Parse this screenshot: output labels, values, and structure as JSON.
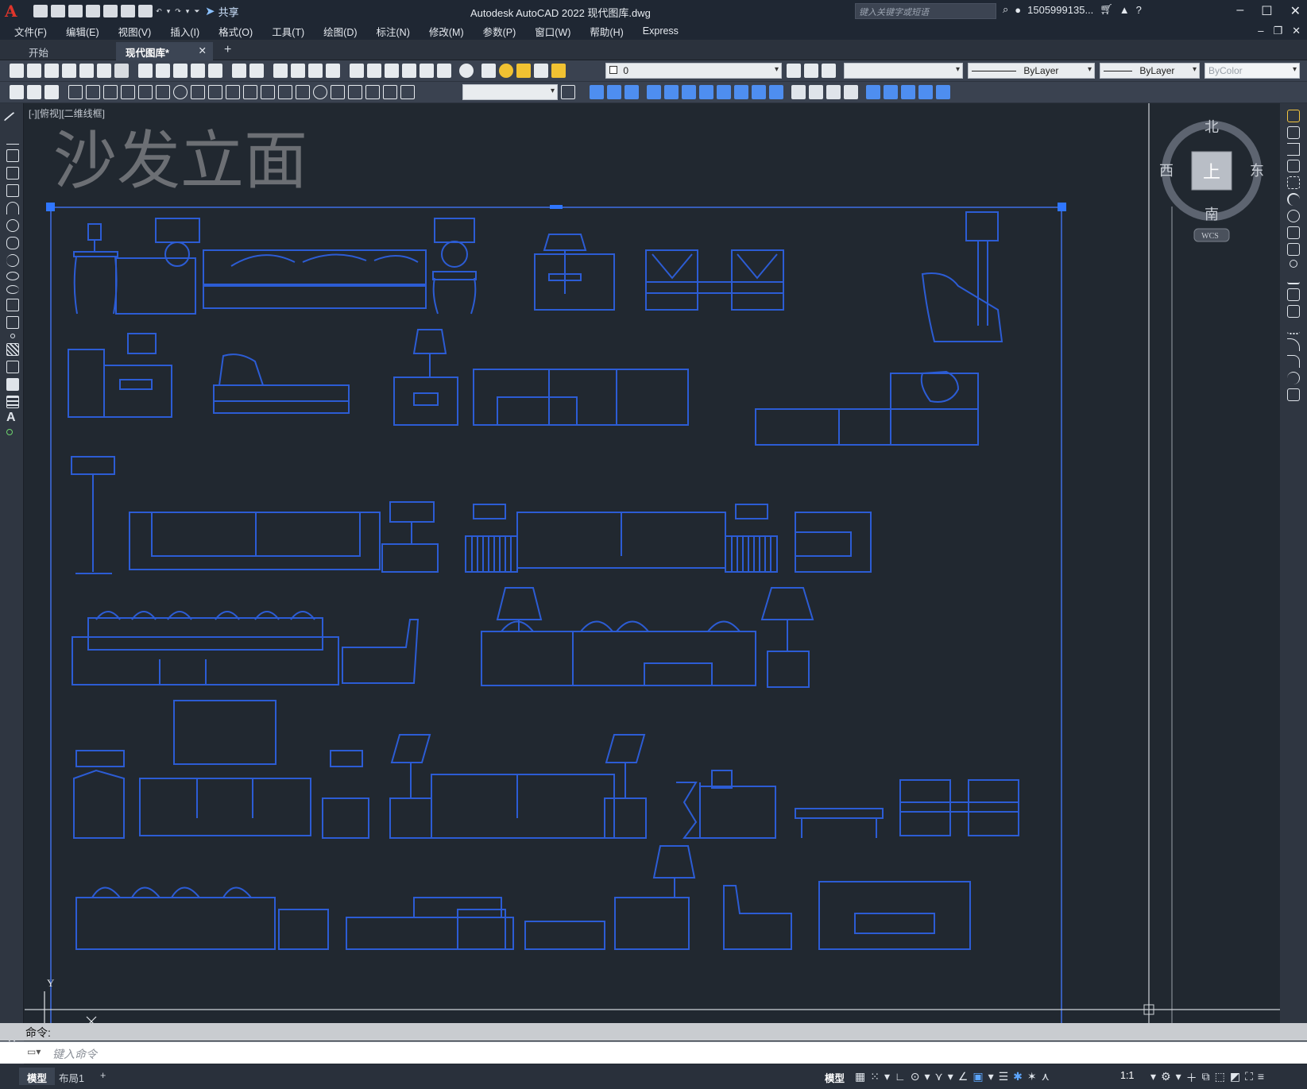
{
  "titlebar": {
    "app_logo": "A",
    "share_label": "共享",
    "title": "Autodesk AutoCAD 2022    现代图库.dwg",
    "search_placeholder": "键入关键字或短语",
    "user_name": "1505999135...",
    "help_label": "?"
  },
  "menu": {
    "items": [
      "文件(F)",
      "编辑(E)",
      "视图(V)",
      "插入(I)",
      "格式(O)",
      "工具(T)",
      "绘图(D)",
      "标注(N)",
      "修改(M)",
      "参数(P)",
      "窗口(W)",
      "帮助(H)",
      "Express"
    ]
  },
  "tabs": {
    "start": "开始",
    "active_doc": "现代图库*",
    "close": "✕",
    "add": "+"
  },
  "toolbar": {
    "layer_value": "0",
    "linetype_value": "ByLayer",
    "lineweight_value": "ByLayer",
    "color_value": "ByColor"
  },
  "viewport": {
    "label": "[-][俯视][二维线框]",
    "drawing_title": "沙发立面"
  },
  "viewcube": {
    "north": "北",
    "south": "南",
    "west": "西",
    "east": "东",
    "top_face": "上",
    "wcs": "WCS"
  },
  "ucs": {
    "x_label": "X",
    "y_label": "Y"
  },
  "command": {
    "history": "命令:",
    "placeholder": "键入命令"
  },
  "layout_tabs": {
    "model": "模型",
    "layout1": "布局1",
    "add": "+"
  },
  "status": {
    "model_label": "模型",
    "scale": "1:1"
  },
  "colors": {
    "canvas": "#212830",
    "drawing_blue": "#2f5fd6",
    "selection_blue": "#3b6fe8"
  }
}
